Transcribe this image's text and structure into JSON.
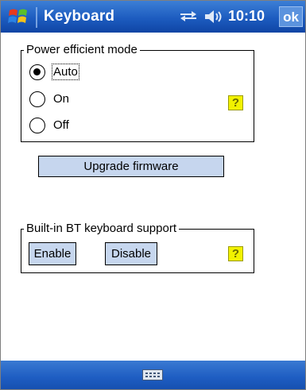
{
  "titlebar": {
    "title": "Keyboard",
    "time": "10:10",
    "ok_label": "ok",
    "icons": [
      "windows-start-icon",
      "connectivity-icon",
      "volume-icon"
    ]
  },
  "power": {
    "group_title": "Power efficient mode",
    "options": [
      {
        "label": "Auto",
        "checked": true
      },
      {
        "label": "On",
        "checked": false
      },
      {
        "label": "Off",
        "checked": false
      }
    ],
    "help_label": "?"
  },
  "upgrade_button": "Upgrade firmware",
  "bt": {
    "group_title": "Built-in BT keyboard support",
    "enable_label": "Enable",
    "disable_label": "Disable",
    "help_label": "?"
  },
  "bottombar": {
    "icons": [
      "keyboard-icon"
    ]
  },
  "colors": {
    "titlebar": "#1d5cc0",
    "button_face": "#c6d6ee",
    "help_yellow": "#f2f200"
  }
}
